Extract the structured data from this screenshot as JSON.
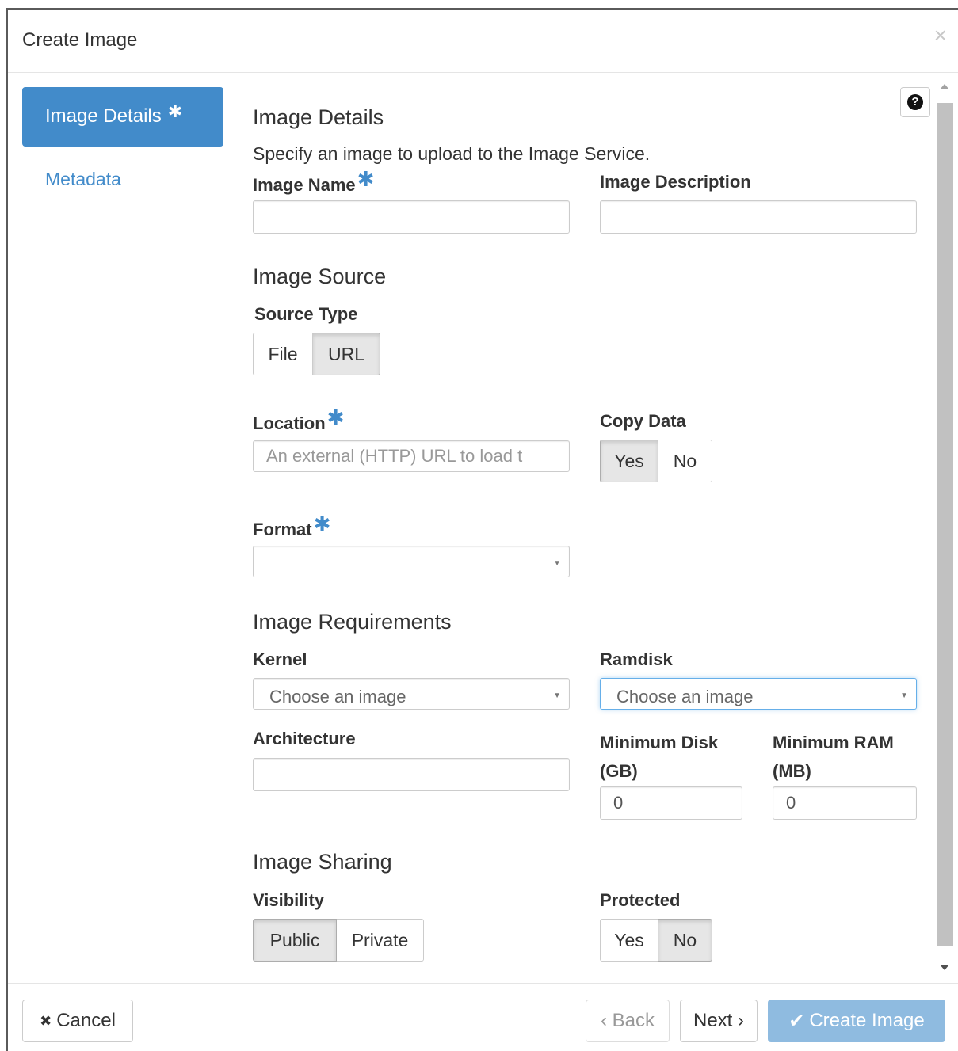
{
  "dialog": {
    "title": "Create Image",
    "close_icon": "×"
  },
  "sidebar": {
    "items": [
      {
        "label": "Image Details",
        "required_mark": "✱",
        "active": true
      },
      {
        "label": "Metadata",
        "active": false
      }
    ]
  },
  "help_icon": "?",
  "image_details": {
    "heading": "Image Details",
    "description": "Specify an image to upload to the Image Service.",
    "image_name_label": "Image Name",
    "image_name_value": "",
    "image_description_label": "Image Description",
    "image_description_value": ""
  },
  "image_source": {
    "heading": "Image Source",
    "source_type_label": "Source Type",
    "source_type_options": [
      "File",
      "URL"
    ],
    "source_type_selected": "URL",
    "location_label": "Location",
    "location_placeholder": "An external (HTTP) URL to load t",
    "copy_data_label": "Copy Data",
    "copy_data_options": [
      "Yes",
      "No"
    ],
    "copy_data_selected": "Yes",
    "format_label": "Format",
    "format_value": ""
  },
  "image_requirements": {
    "heading": "Image Requirements",
    "kernel_label": "Kernel",
    "kernel_value": "Choose an image",
    "ramdisk_label": "Ramdisk",
    "ramdisk_value": "Choose an image",
    "architecture_label": "Architecture",
    "architecture_value": "",
    "min_disk_label_1": "Minimum Disk",
    "min_disk_label_2": "(GB)",
    "min_disk_value": "0",
    "min_ram_label_1": "Minimum RAM",
    "min_ram_label_2": "(MB)",
    "min_ram_value": "0"
  },
  "image_sharing": {
    "heading": "Image Sharing",
    "visibility_label": "Visibility",
    "visibility_options": [
      "Public",
      "Private"
    ],
    "visibility_selected": "Public",
    "protected_label": "Protected",
    "protected_options": [
      "Yes",
      "No"
    ],
    "protected_selected": "No"
  },
  "footer": {
    "cancel_icon": "✖",
    "cancel_label": "Cancel",
    "back_label": "‹ Back",
    "next_label": "Next ›",
    "create_icon": "✔",
    "create_label": "Create Image"
  },
  "colors": {
    "primary": "#428bca",
    "primary_disabled": "#8fbbe0",
    "active_toggle": "#e6e6e6"
  }
}
